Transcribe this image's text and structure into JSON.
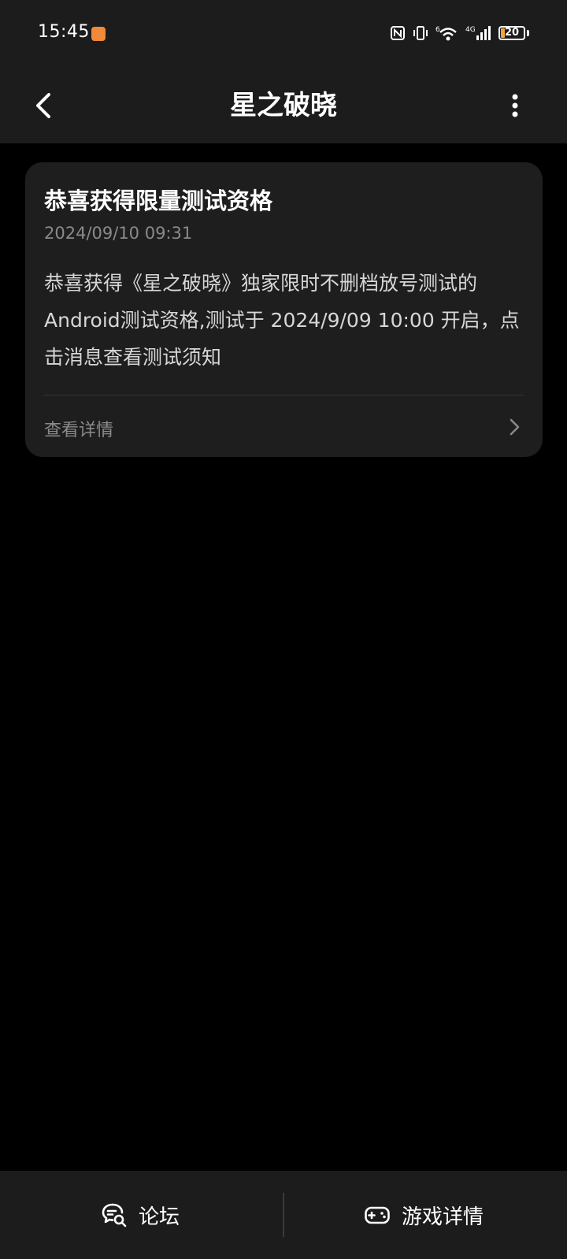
{
  "status_bar": {
    "time": "15:45",
    "network_label": "4G",
    "signal_label": "6",
    "battery_level": "20",
    "battery_color": "#f3a43b",
    "app_icon": "shield-app-icon"
  },
  "header": {
    "title": "星之破晓",
    "back_icon": "chevron-left-icon",
    "more_icon": "more-vertical-icon"
  },
  "message": {
    "title": "恭喜获得限量测试资格",
    "time": "2024/09/10 09:31",
    "body": "恭喜获得《星之破晓》独家限时不删档放号测试的Android测试资格,测试于 2024/9/09 10:00 开启，点击消息查看测试须知",
    "footer_label": "查看详情",
    "footer_icon": "chevron-right-icon"
  },
  "bottom_bar": {
    "forum_label": "论坛",
    "forum_icon": "forum-chat-icon",
    "game_label": "游戏详情",
    "game_icon": "gamepad-icon"
  },
  "colors": {
    "background": "#000000",
    "surface": "#1c1c1c",
    "card": "#1e1e1e",
    "muted_text": "#8a8a8a"
  }
}
